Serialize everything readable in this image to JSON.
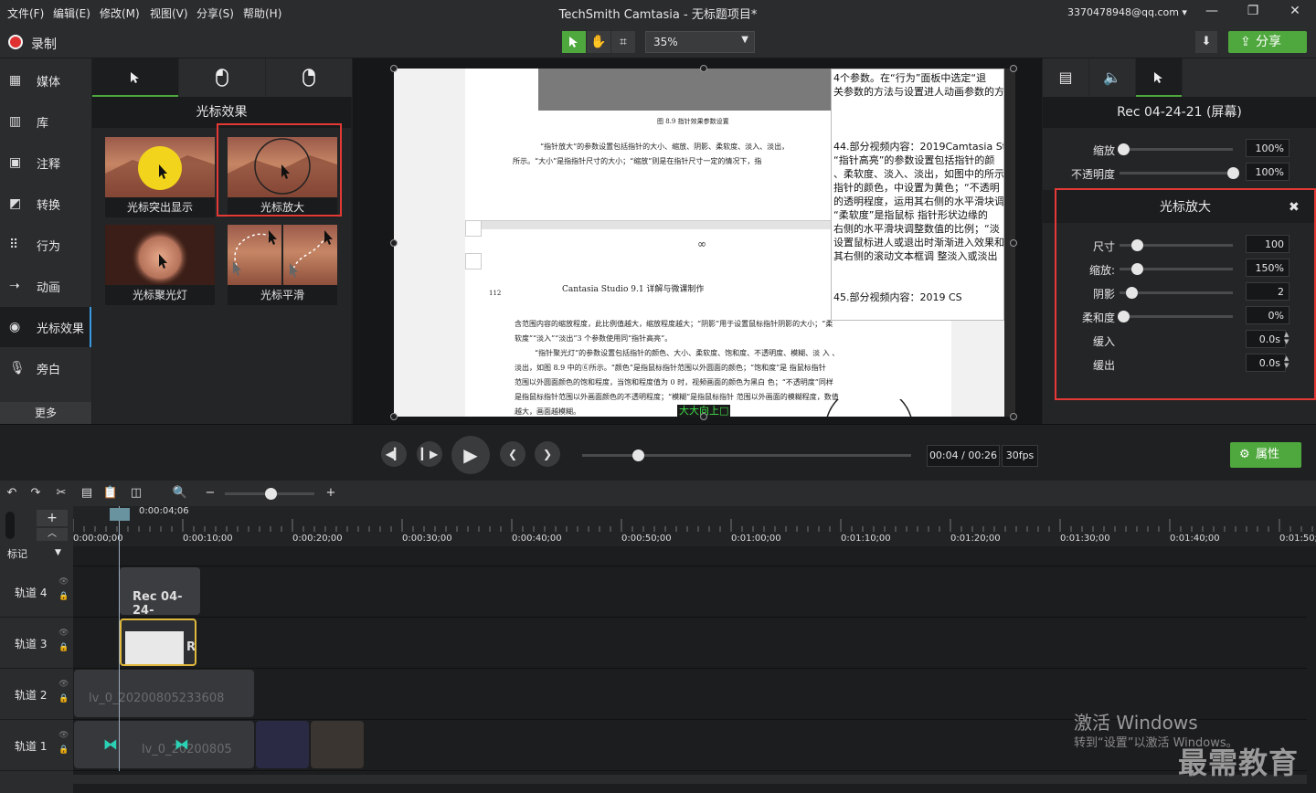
{
  "menu": [
    "文件(F)",
    "编辑(E)",
    "修改(M)",
    "视图(V)",
    "分享(S)",
    "帮助(H)"
  ],
  "app_title": "TechSmith Camtasia - 无标题项目*",
  "account": "3370478948@qq.com ▾",
  "window_controls": {
    "minimize": "—",
    "restore": "❐",
    "close": "✕"
  },
  "toolbar": {
    "record_label": "录制",
    "zoom": "35%",
    "share_label": "分享"
  },
  "sidebar": {
    "items": [
      {
        "label": "媒体",
        "icon": "media-icon"
      },
      {
        "label": "库",
        "icon": "library-icon"
      },
      {
        "label": "注释",
        "icon": "annotation-icon"
      },
      {
        "label": "转换",
        "icon": "transition-icon"
      },
      {
        "label": "行为",
        "icon": "behavior-icon"
      },
      {
        "label": "动画",
        "icon": "animation-icon"
      },
      {
        "label": "光标效果",
        "icon": "cursor-effect-icon"
      },
      {
        "label": "旁白",
        "icon": "microphone-icon"
      }
    ],
    "more": "更多"
  },
  "effects_panel": {
    "title": "光标效果",
    "thumbs": [
      {
        "label": "光标突出显示"
      },
      {
        "label": "光标放大"
      },
      {
        "label": "光标聚光灯"
      },
      {
        "label": "光标平滑"
      }
    ]
  },
  "canvas": {
    "doc_lines_top": [
      "图 8.9  指针效果参数设置"
    ],
    "doc_para1": [
      "“指针放大”的参数设置包括指针的大小、缩放、阴影、柔软度、淡入、淡出，",
      "所示。“大小”是指指针尺寸的大小；“缩放”则是在指针尺寸一定的情况下，指"
    ],
    "page_number": "112",
    "book_title": "Cantasia Studio 9.1 详解与微课制作",
    "doc_para2": [
      "含范围内容的缩放程度，此比例值越大，缩放程度越大；“阴影”用于设置鼠标指针阴影的大小；“柔",
      "软度”“淡入”“淡出”3 个参数使用同“指针高亮”。",
      "“指针聚光灯”的参数设置包括指针的颜色、大小、柔软度、饱和度、不透明度、模糊、淡 入 、",
      "淡出，如图 8.9 中的⑥所示。“颜色”是指鼠标指针范围以外圆面的颜色；“饱和度”是 指鼠标指针",
      "范围以外圆面颜色的饱和程度，当饱和程度值为 0 时，视频画面的颜色为黑白 色；“不透明度”同样",
      "是指鼠标指针范围以外画面颜色的不透明程度；“模糊”是指鼠标指针 范围以外画面的模糊程度，数值",
      "越大，画面越模糊。"
    ],
    "side_text": [
      "4个参数。在“行为”面板中选定“退",
      "关参数的方法与设置进人动画参数的方",
      "",
      "",
      "",
      "44.部分视频内容：2019Camtasia St",
      "“指针高亮”的参数设置包括指针的颜",
      "、柔软度、淡入、淡出，如图中的所示",
      "指针的颜色，中设置为黄色；“不透明",
      "的透明程度，运用其右侧的水平滑块调",
      "“柔软度”是指鼠标 指针形状边缘的",
      "右侧的水平滑块调整数值的比例；“淡",
      "设置鼠标进人或退出时渐渐进入效果和",
      "其右侧的滚动文本框调 整淡入或淡出",
      "",
      "",
      "45.部分视频内容：2019 CS"
    ],
    "caption": "大大向上□"
  },
  "right_panel": {
    "clip_title": "Rec 04-24-21 (屏幕)",
    "scale_label": "缩放",
    "scale_value": "100%",
    "opacity_label": "不透明度",
    "opacity_value": "100%",
    "cursor_box": {
      "title": "光标放大",
      "rows": [
        {
          "label": "尺寸",
          "value": "100"
        },
        {
          "label": "缩放:",
          "value": "150%"
        },
        {
          "label": "阴影",
          "value": "2"
        },
        {
          "label": "柔和度",
          "value": "0%"
        },
        {
          "label": "缓入",
          "value": "0.0s"
        },
        {
          "label": "缓出",
          "value": "0.0s"
        }
      ]
    }
  },
  "playback": {
    "time": "00:04 / 00:26",
    "fps": "30fps",
    "properties_label": "属性"
  },
  "timeline": {
    "playhead_time": "0:00:04;06",
    "marker_label": "标记",
    "ticks": [
      "0:00:00;00",
      "0:00:10;00",
      "0:00:20;00",
      "0:00:30;00",
      "0:00:40;00",
      "0:00:50;00",
      "0:01:00;00",
      "0:01:10;00",
      "0:01:20;00",
      "0:01:30;00",
      "0:01:40;00",
      "0:01:50;"
    ],
    "tracks": [
      "轨道 4",
      "轨道 3",
      "轨道 2",
      "轨道 1"
    ],
    "clips": {
      "track4": "Rec 04-24-",
      "track3": "R",
      "track2": "lv_0_20200805233608",
      "track1": "lv_0_20200805"
    }
  },
  "watermark": {
    "line1": "激活 Windows",
    "line2": "转到“设置”以激活 Windows。",
    "brand": "最需教育"
  }
}
